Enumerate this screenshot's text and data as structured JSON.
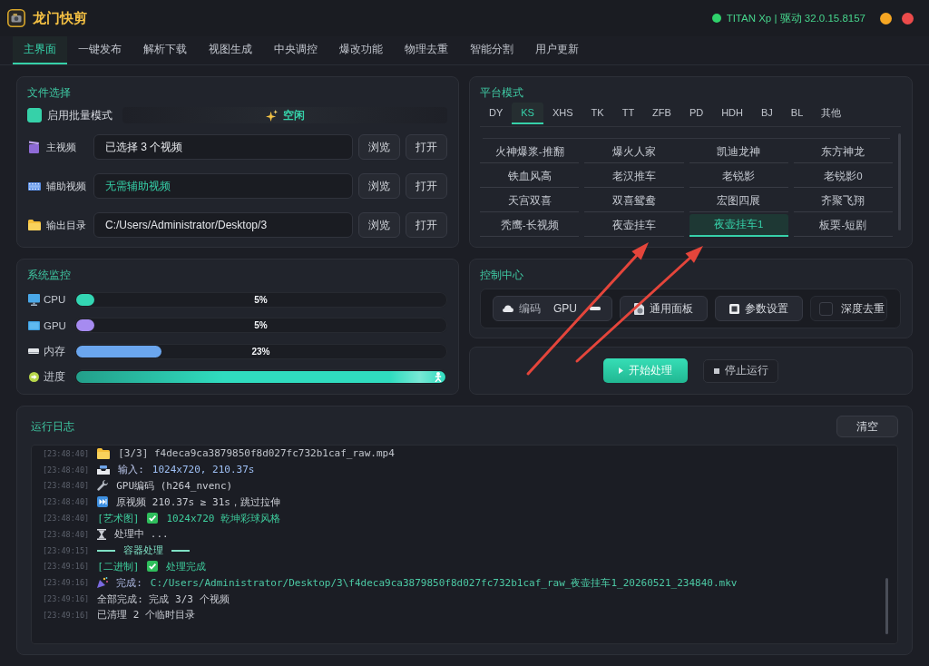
{
  "window": {
    "title": "龙门快剪",
    "gpu": {
      "online": true,
      "text": "TITAN Xp | 驱动 32.0.15.8157"
    }
  },
  "tabs": [
    {
      "label": "主界面",
      "selected": true
    },
    {
      "label": "一键发布",
      "selected": false
    },
    {
      "label": "解析下载",
      "selected": false
    },
    {
      "label": "视图生成",
      "selected": false
    },
    {
      "label": "中央调控",
      "selected": false
    },
    {
      "label": "爆改功能",
      "selected": false
    },
    {
      "label": "物理去重",
      "selected": false
    },
    {
      "label": "智能分割",
      "selected": false
    },
    {
      "label": "用户更新",
      "selected": false
    }
  ],
  "file_selection": {
    "title": "文件选择",
    "batch_mode": {
      "label": "启用批量模式",
      "checked": true
    },
    "status": "空闲",
    "rows": [
      {
        "kind": "main",
        "label": "主视频",
        "value": "已选择 3 个视频",
        "buttons": [
          "浏览",
          "打开"
        ]
      },
      {
        "kind": "aux",
        "label": "辅助视频",
        "placeholder": "无需辅助视频",
        "buttons": [
          "浏览",
          "打开"
        ]
      },
      {
        "kind": "output",
        "label": "输出目录",
        "value": "C:/Users/Administrator/Desktop/3",
        "buttons": [
          "浏览",
          "打开"
        ]
      }
    ]
  },
  "platform_mode": {
    "title": "平台模式",
    "tabs": [
      {
        "label": "DY",
        "selected": false
      },
      {
        "label": "KS",
        "selected": true
      },
      {
        "label": "XHS",
        "selected": false
      },
      {
        "label": "TK",
        "selected": false
      },
      {
        "label": "TT",
        "selected": false
      },
      {
        "label": "ZFB",
        "selected": false
      },
      {
        "label": "PD",
        "selected": false
      },
      {
        "label": "HDH",
        "selected": false
      },
      {
        "label": "BJ",
        "selected": false
      },
      {
        "label": "BL",
        "selected": false
      },
      {
        "label": "其他",
        "selected": false
      }
    ],
    "presets": [
      {
        "label": "火神爆浆-推翻",
        "selected": false
      },
      {
        "label": "爆火人家",
        "selected": false
      },
      {
        "label": "凯迪龙神",
        "selected": false
      },
      {
        "label": "东方神龙",
        "selected": false
      },
      {
        "label": "铁血风高",
        "selected": false
      },
      {
        "label": "老汉推车",
        "selected": false
      },
      {
        "label": "老锐影",
        "selected": false
      },
      {
        "label": "老锐影0",
        "selected": false
      },
      {
        "label": "天宫双喜",
        "selected": false
      },
      {
        "label": "双喜鸳鸯",
        "selected": false
      },
      {
        "label": "宏图四展",
        "selected": false
      },
      {
        "label": "齐聚飞翔",
        "selected": false
      },
      {
        "label": "秃鹰-长视频",
        "selected": false
      },
      {
        "label": "夜壶挂车",
        "selected": false
      },
      {
        "label": "夜壶挂车1",
        "selected": true
      },
      {
        "label": "板栗-短剧",
        "selected": false
      }
    ]
  },
  "system_monitor": {
    "title": "系统监控",
    "rows": [
      {
        "kind": "cpu",
        "label": "CPU",
        "level": 0.05,
        "reading": "5%",
        "color": "#33d6b3"
      },
      {
        "kind": "gpu",
        "label": "GPU",
        "level": 0.05,
        "reading": "5%",
        "color": "#a68bf0"
      },
      {
        "kind": "memory",
        "label": "内存",
        "level": 0.23,
        "reading": "23%",
        "color": "#6ba6ee"
      },
      {
        "kind": "progress",
        "label": "进度",
        "level": 1,
        "color": "#30dcbf"
      }
    ]
  },
  "control_center": {
    "title": "控制中心",
    "encoder": {
      "label": "编码",
      "value": "GPU"
    },
    "buttons": [
      {
        "kind": "panel",
        "label": "通用面板"
      },
      {
        "kind": "settings",
        "label": "参数设置"
      }
    ],
    "dedupe": {
      "label": "深度去重",
      "checked": false
    }
  },
  "actions": [
    {
      "kind": "start",
      "label": "开始处理"
    },
    {
      "kind": "stop",
      "label": "停止运行"
    }
  ],
  "log": {
    "title": "运行日志",
    "clear_button": "清空",
    "lines": [
      {
        "time": "[23:48:40]",
        "kind": "file",
        "text": "[3/3] f4deca9ca3879850f8d027fc732b1caf_raw.mp4"
      },
      {
        "time": "[23:48:40]",
        "kind": "input",
        "label": "输入:",
        "text": "1024x720, 210.37s"
      },
      {
        "time": "[23:48:40]",
        "kind": "encoder",
        "text": "GPU编码 (h264_nvenc)"
      },
      {
        "time": "[23:48:40]",
        "kind": "skip",
        "text": "原视频 210.37s ≥ 31s，跳过拉伸"
      },
      {
        "time": "[23:48:40]",
        "kind": "result",
        "tag": "[艺术图]",
        "text": "1024x720 乾坤彩球风格"
      },
      {
        "time": "[23:48:40]",
        "kind": "progress",
        "text": "处理中 ..."
      },
      {
        "time": "[23:49:15]",
        "kind": "section",
        "text": "容器处理"
      },
      {
        "time": "[23:49:16]",
        "kind": "result",
        "tag": "[二进制]",
        "text": "处理完成"
      },
      {
        "time": "[23:49:16]",
        "kind": "done",
        "label": "完成:",
        "text": "C:/Users/Administrator/Desktop/3\\f4deca9ca3879850f8d027fc732b1caf_raw_夜壶挂车1_20260521_234840.mkv"
      },
      {
        "time": "[23:49:16]",
        "kind": "plain",
        "text": "全部完成: 完成 3/3 个视频"
      },
      {
        "time": "[23:49:16]",
        "kind": "plain",
        "text": "已清理 2 个临时目录"
      }
    ]
  }
}
